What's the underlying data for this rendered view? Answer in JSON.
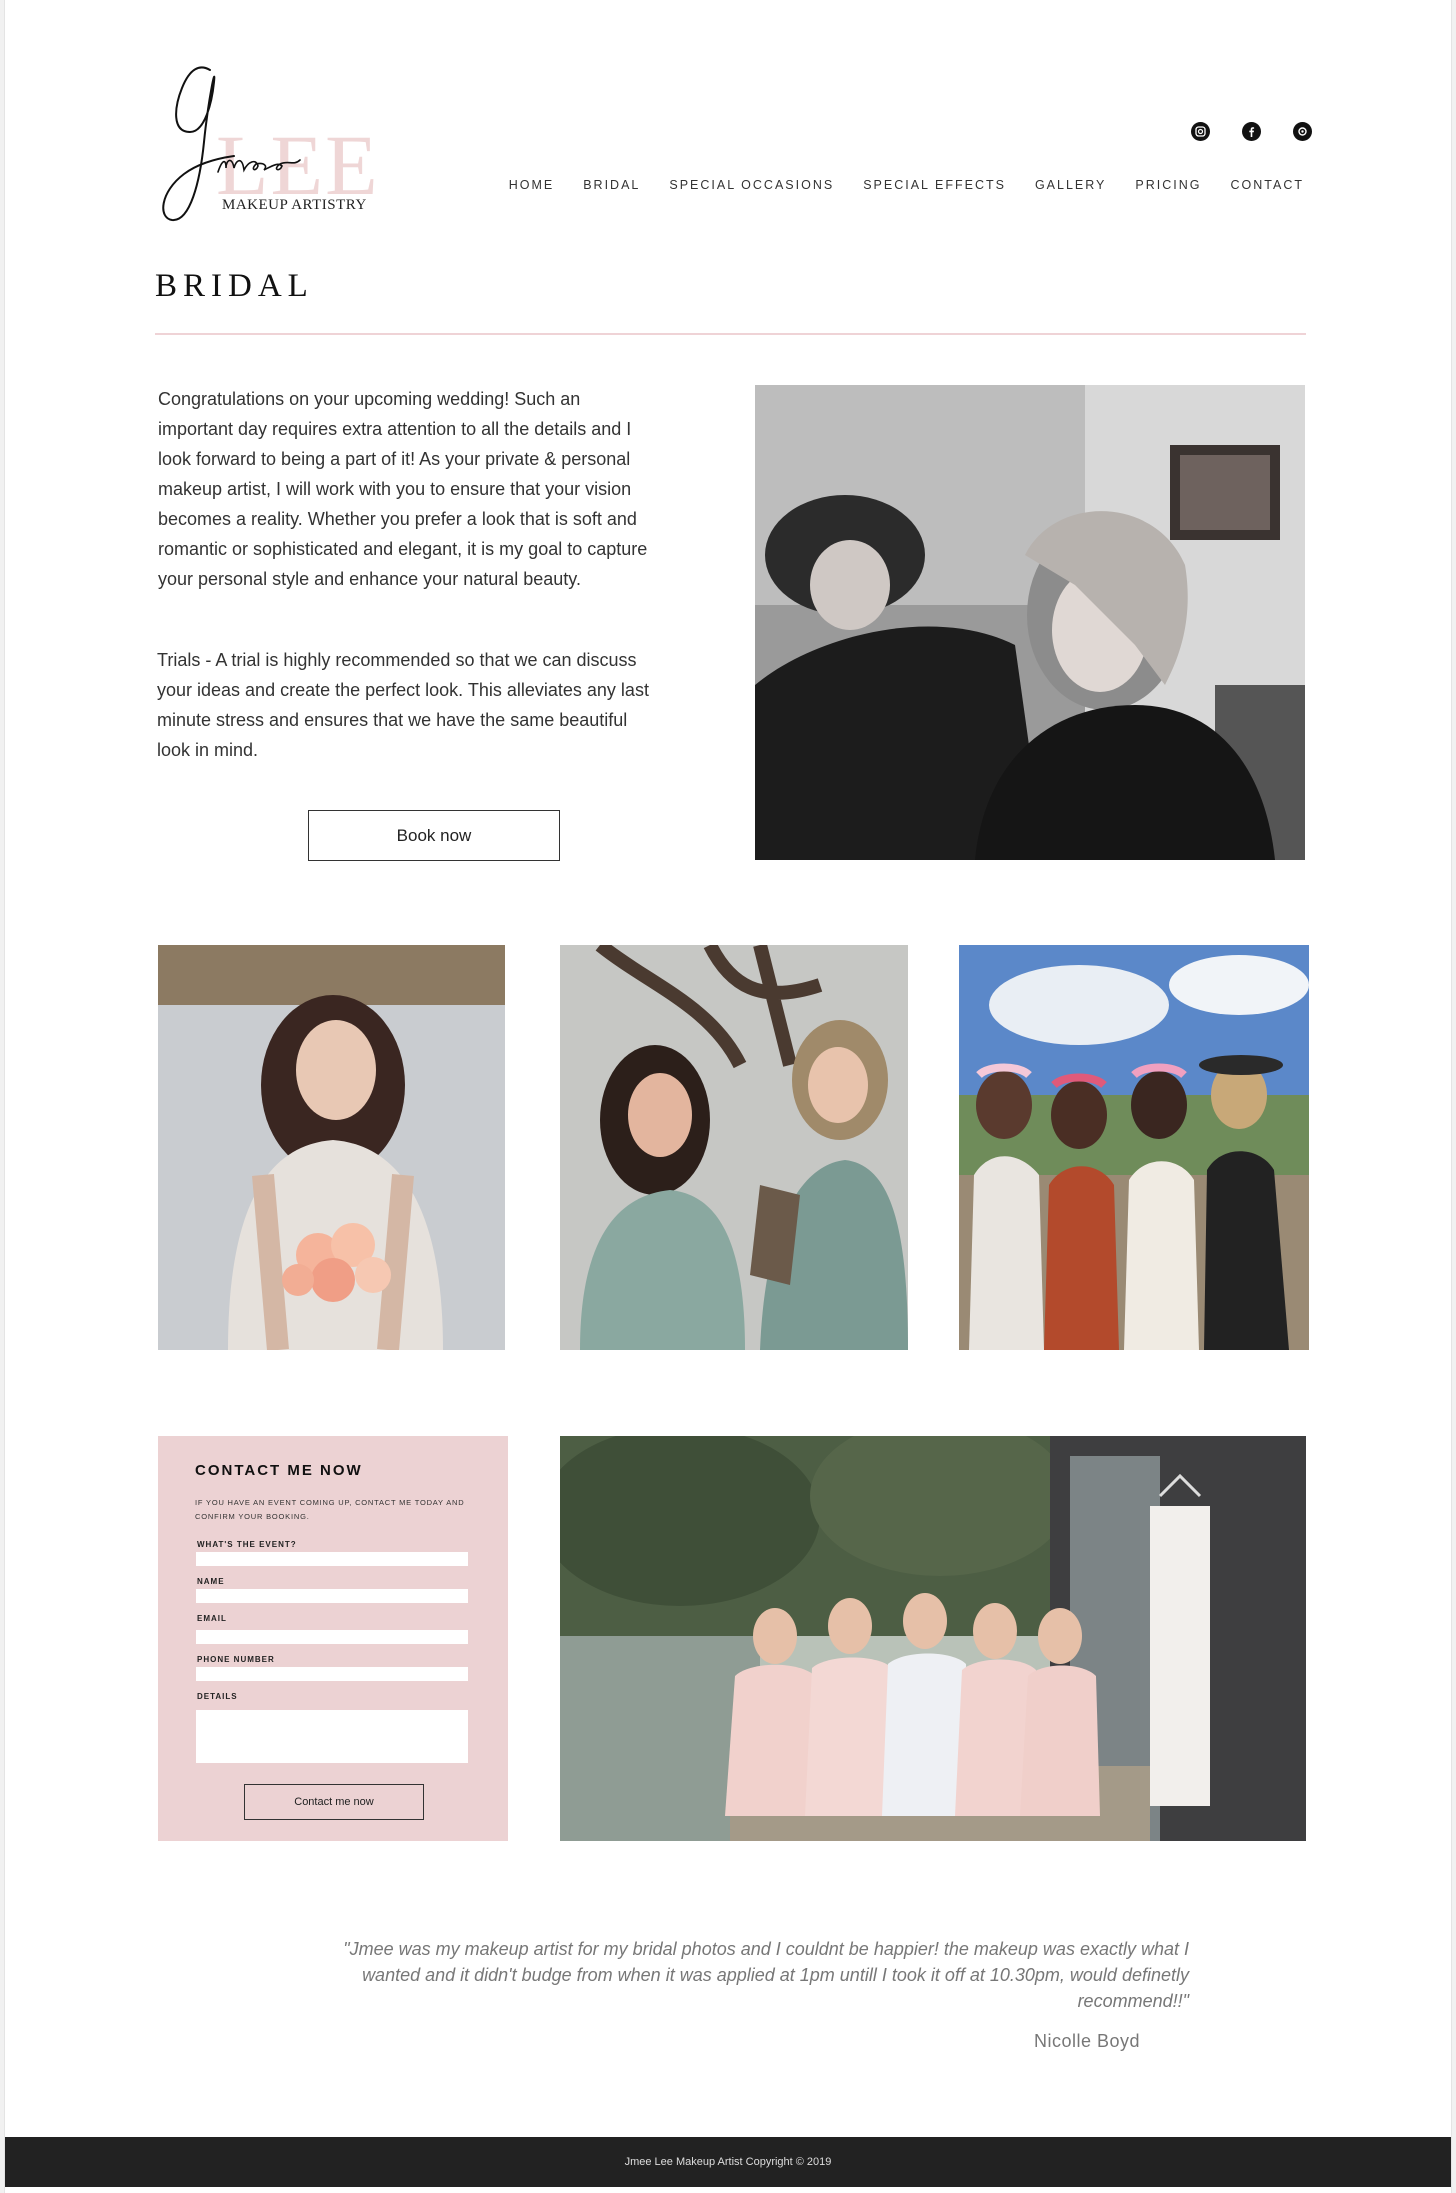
{
  "brand": {
    "script_name": "Jmee",
    "name": "LEE",
    "subtitle": "MAKEUP ARTISTRY"
  },
  "social": [
    {
      "icon": "instagram-icon"
    },
    {
      "icon": "facebook-icon"
    },
    {
      "icon": "tripadvisor-icon"
    }
  ],
  "nav": {
    "items": [
      "HOME",
      "BRIDAL",
      "SPECIAL OCCASIONS",
      "SPECIAL EFFECTS",
      "GALLERY",
      "PRICING",
      "CONTACT"
    ]
  },
  "page": {
    "title": "BRIDAL",
    "intro": "Congratulations on your upcoming wedding! Such an important day requires extra attention to all the details and I look forward to being a part of it! As your private & personal makeup artist, I will work with you to ensure that your vision becomes a reality. Whether you prefer a look that is soft and romantic or sophisticated and elegant, it is my goal to capture your personal style and enhance your natural beauty.",
    "trials": "Trials - A trial is highly recommended so that we can discuss your ideas and create the perfect look. This alleviates any last minute stress and ensures that we have the same beautiful look in mind.",
    "book_label": "Book now"
  },
  "contact": {
    "title": "CONTACT ME NOW",
    "subtitle": "If you have an event coming up, contact me today and confirm your booking.",
    "fields": {
      "event": "WHAT'S THE EVENT?",
      "name": "NAME",
      "email": "EMAIL",
      "phone": "PHONE NUMBER",
      "details": "DETAILS"
    },
    "button": "Contact me now"
  },
  "testimonial": {
    "quote": "\"Jmee was my makeup artist for my bridal photos and I couldnt be happier! the makeup was exactly what I wanted and it didn't budge from when it was applied at 1pm untill I took it off at 10.30pm, would definetly recommend!!\"",
    "author": "Nicolle Boyd"
  },
  "footer": {
    "copyright": "Jmee Lee Makeup Artist Copyright © 2019"
  },
  "colors": {
    "accent_pink": "#ecd2d3",
    "footer_bg": "#222222"
  }
}
